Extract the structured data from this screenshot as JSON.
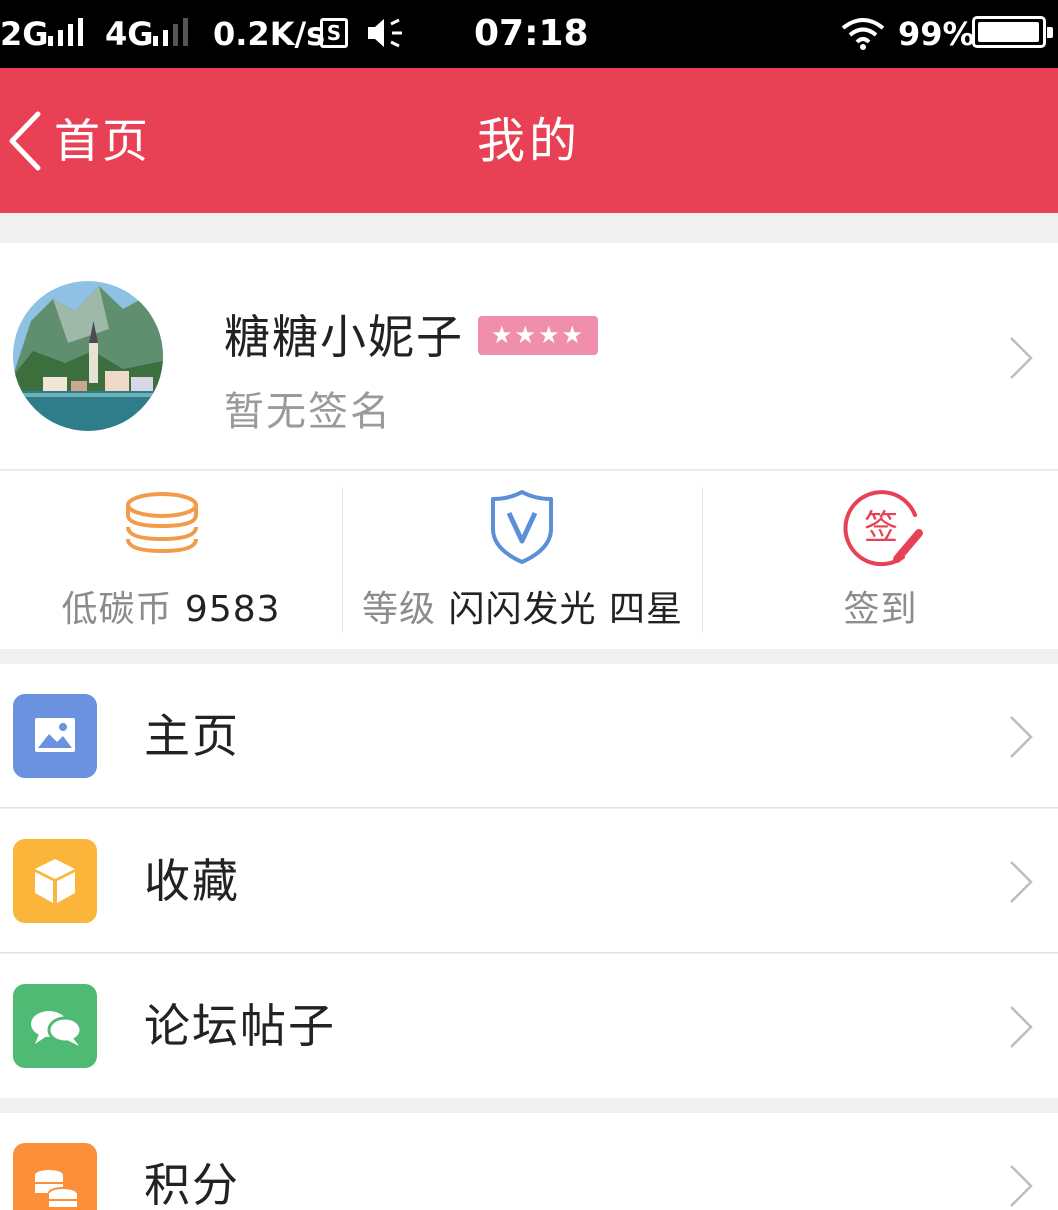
{
  "status_bar": {
    "network1": "2G",
    "network2": "4G",
    "speed": "0.2K/s",
    "s_icon": "S",
    "time": "07:18",
    "battery": "99%",
    "battery_level": 0.99,
    "icons": [
      "signal-icon",
      "speaker-icon",
      "wifi-icon",
      "battery-icon"
    ]
  },
  "header": {
    "back_label": "首页",
    "title": "我的",
    "background": "#e84155"
  },
  "profile": {
    "name": "糖糖小妮子",
    "badge": "★★★★",
    "signature": "暂无签名"
  },
  "stats": [
    {
      "icon": "coins-stack-icon",
      "label": "低碳币",
      "value": "9583",
      "color": "#f39b48"
    },
    {
      "icon": "shield-v-icon",
      "label": "等级",
      "value": "闪闪发光 四星",
      "color": "#5b8fd8"
    },
    {
      "icon": "sign-in-icon",
      "label": "签到",
      "glyph": "签",
      "color": "#e84155"
    }
  ],
  "menu": [
    {
      "label": "主页",
      "icon": "image-icon",
      "color": "#6b92df"
    },
    {
      "label": "收藏",
      "icon": "box-icon",
      "color": "#fbb53a"
    },
    {
      "label": "论坛帖子",
      "icon": "chat-bubbles-icon",
      "color": "#4fba74"
    },
    {
      "label": "积分",
      "icon": "coins-icon",
      "color": "#fb8f3a"
    }
  ]
}
